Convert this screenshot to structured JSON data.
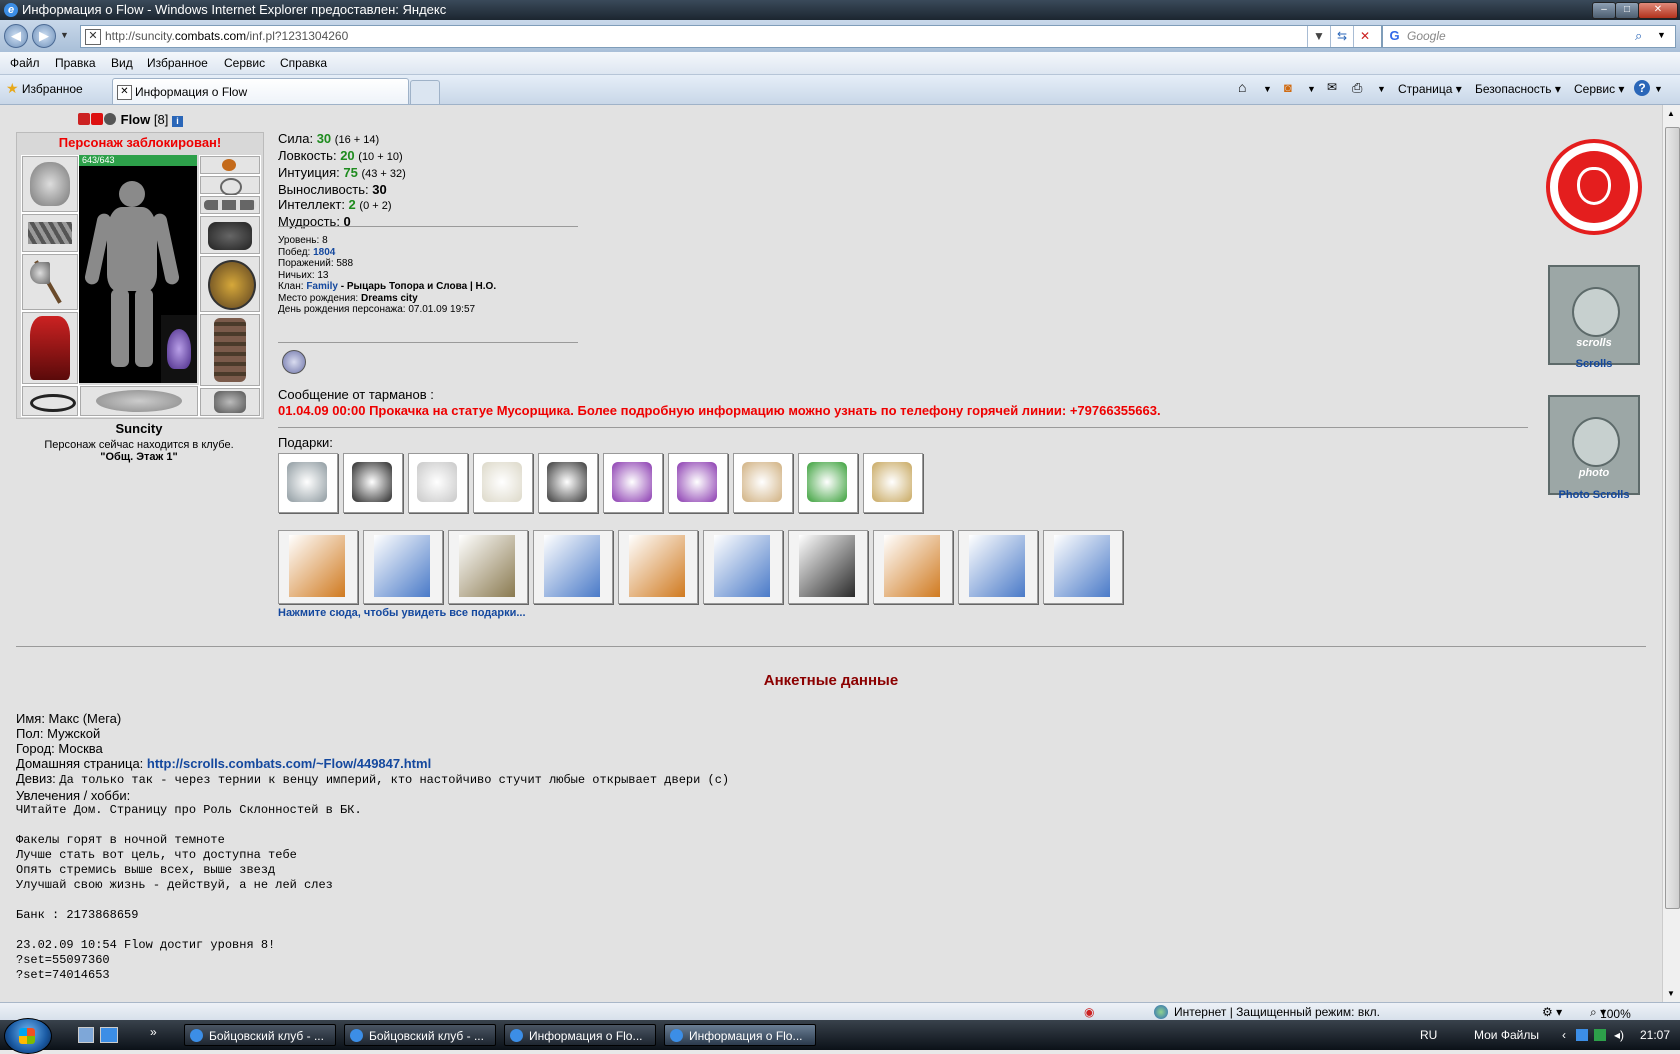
{
  "window": {
    "title": "Информация о Flow - Windows Internet Explorer предоставлен: Яндекс"
  },
  "address": {
    "url_prefix": "http://suncity.",
    "url_domain": "combats.com",
    "url_path": "/inf.pl?1231304260",
    "search_placeholder": "Google"
  },
  "menu": [
    "Файл",
    "Правка",
    "Вид",
    "Избранное",
    "Сервис",
    "Справка"
  ],
  "tabs": {
    "favorites": "Избранное",
    "active": "Информация о Flow"
  },
  "commandbar": {
    "page": "Страница",
    "security": "Безопасность",
    "tools": "Сервис",
    "help": "?"
  },
  "character": {
    "name": "Flow",
    "level": "[8]",
    "blocked": "Персонаж заблокирован!",
    "hp": "643/643",
    "city": "Suncity",
    "location": "Персонаж сейчас находится в клубе.",
    "room": "\"Общ. Этаж 1\""
  },
  "stats": [
    {
      "label": "Сила: ",
      "value": "30",
      "sub": "(16 + 14)"
    },
    {
      "label": "Ловкость: ",
      "value": "20",
      "sub": "(10 + 10)"
    },
    {
      "label": "Интуиция: ",
      "value": "75",
      "sub": "(43 + 32)"
    },
    {
      "label": "Выносливость: ",
      "value": "30",
      "sub": ""
    },
    {
      "label": "Интеллект: ",
      "value": "2",
      "sub": "(0 + 2)"
    },
    {
      "label": "Мудрость: ",
      "value": "0",
      "sub": ""
    }
  ],
  "info": {
    "level": "Уровень: 8",
    "wins_label": "Побед: ",
    "wins": "1804",
    "losses": "Поражений: 588",
    "draws": "Ничьих: 13",
    "clan_label": "Клан: ",
    "clan": "Family",
    "clan_rank": " - Рыцарь Топора и Слова | Н.О.",
    "birthplace_label": "Место рождения: ",
    "birthplace": "Dreams city",
    "birthday": "День рождения персонажа: 07.01.09 19:57"
  },
  "message": {
    "label": "Сообщение от тарманов :",
    "text": "01.04.09 00:00 Прокачка на статуе Мусорщика. Более подробную информацию можно узнать по телефону горячей линии: +79766355663."
  },
  "gifts": {
    "label": "Подарки:",
    "row1": [
      "#8e9aa0",
      "#2a2a2a",
      "#c8c8c8",
      "#dcd8c8",
      "#3a3a3a",
      "#8a3ab0",
      "#8a3ab0",
      "#d0b080",
      "#3aa03a",
      "#c8a860"
    ],
    "row2": [
      "#d07a20",
      "#4a7ac8",
      "#8a7a50",
      "#4a7ac8",
      "#d07a20",
      "#4a7ac8",
      "#2a2a2a",
      "#d07a20",
      "#4a7ac8",
      "#4a7ac8"
    ],
    "link": "Нажмите сюда, чтобы увидеть все подарки..."
  },
  "side": {
    "scrolls_word": "scrolls",
    "scrolls": "Scrolls",
    "photo_word": "photo",
    "photo": "Photo Scrolls"
  },
  "profile": {
    "heading": "Анкетные данные",
    "name": "Имя: Макс (Мега)",
    "gender": "Пол: Мужской",
    "city": "Город: Москва",
    "homepage_label": "Домашняя страница: ",
    "homepage": "http://scrolls.combats.com/~Flow/449847.html",
    "motto_label": "Девиз: ",
    "motto": "Да только так - через тернии к венцу империй, кто настойчиво стучит любые открывает двери (с)",
    "hobby_label": "Увлечения / хобби:",
    "lines": [
      "ЧИтайте Дом. Страницу про Роль Склонностей в БК.",
      "",
      "Факелы горят в ночной темноте",
      "Лучше стать вот цель, что доступна тебе",
      "Опять стремись выше всех, выше звезд",
      "Улучшай свою жизнь - действуй, а не лей слез",
      "",
      "Банк : 2173868659",
      "",
      "23.02.09 10:54 Flow достиг уровня 8!",
      "?set=55097360",
      "?set=74014653"
    ]
  },
  "statusbar": {
    "zone": "Интернет | Защищенный режим: вкл.",
    "zoom": "100%"
  },
  "taskbar": {
    "buttons": [
      "Бойцовский клуб - ...",
      "Бойцовский клуб - ...",
      "Информация о Flo...",
      "Информация о Flo..."
    ],
    "lang": "RU",
    "folder": "Мои Файлы",
    "time": "21:07"
  }
}
